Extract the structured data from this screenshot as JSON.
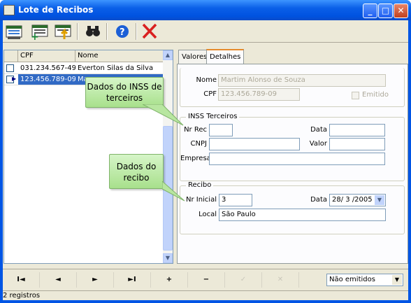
{
  "window": {
    "title": "Lote de Recibos",
    "minimize_icon": "minimize-icon",
    "maximize_icon": "maximize-icon",
    "close_icon": "close-icon"
  },
  "grid": {
    "columns": [
      "CPF",
      "Nome"
    ],
    "rows": [
      {
        "cpf": "031.234.567-49",
        "nome": "Everton Silas da Silva",
        "selected": false
      },
      {
        "cpf": "123.456.789-09",
        "nome": "Ma",
        "selected": true
      }
    ]
  },
  "tabs": [
    "Valores",
    "Detalhes"
  ],
  "detalhes": {
    "nome_label": "Nome",
    "nome_value": "Martim Alonso de Souza",
    "cpf_label": "CPF",
    "cpf_value": "123.456.789-09",
    "emitido_label": "Emitido"
  },
  "inss": {
    "title": "INSS Terceiros",
    "nrrec_label": "Nr Rec",
    "data_label": "Data",
    "cnpj_label": "CNPJ",
    "valor_label": "Valor",
    "empresa_label": "Empresa"
  },
  "recibo": {
    "title": "Recibo",
    "nrinicial_label": "Nr Inicial",
    "nrinicial_value": "3",
    "data_label": "Data",
    "data_value": "28/ 3 /2005",
    "local_label": "Local",
    "local_value": "São Paulo"
  },
  "callouts": {
    "inss": "Dados do INSS de terceiros",
    "recibo": "Dados do recibo"
  },
  "nav": {
    "first": "I◄",
    "prior": "◄",
    "next": "►",
    "last": "►I",
    "insert": "+",
    "delete": "−",
    "post": "✓",
    "cancel": "✕"
  },
  "filter": {
    "selected": "Não emitidos"
  },
  "status": {
    "count": "2 registros"
  },
  "colors": {
    "title_bar": "#0a5fe8",
    "selection": "#316ac5",
    "callout": "#b8e6a0"
  }
}
